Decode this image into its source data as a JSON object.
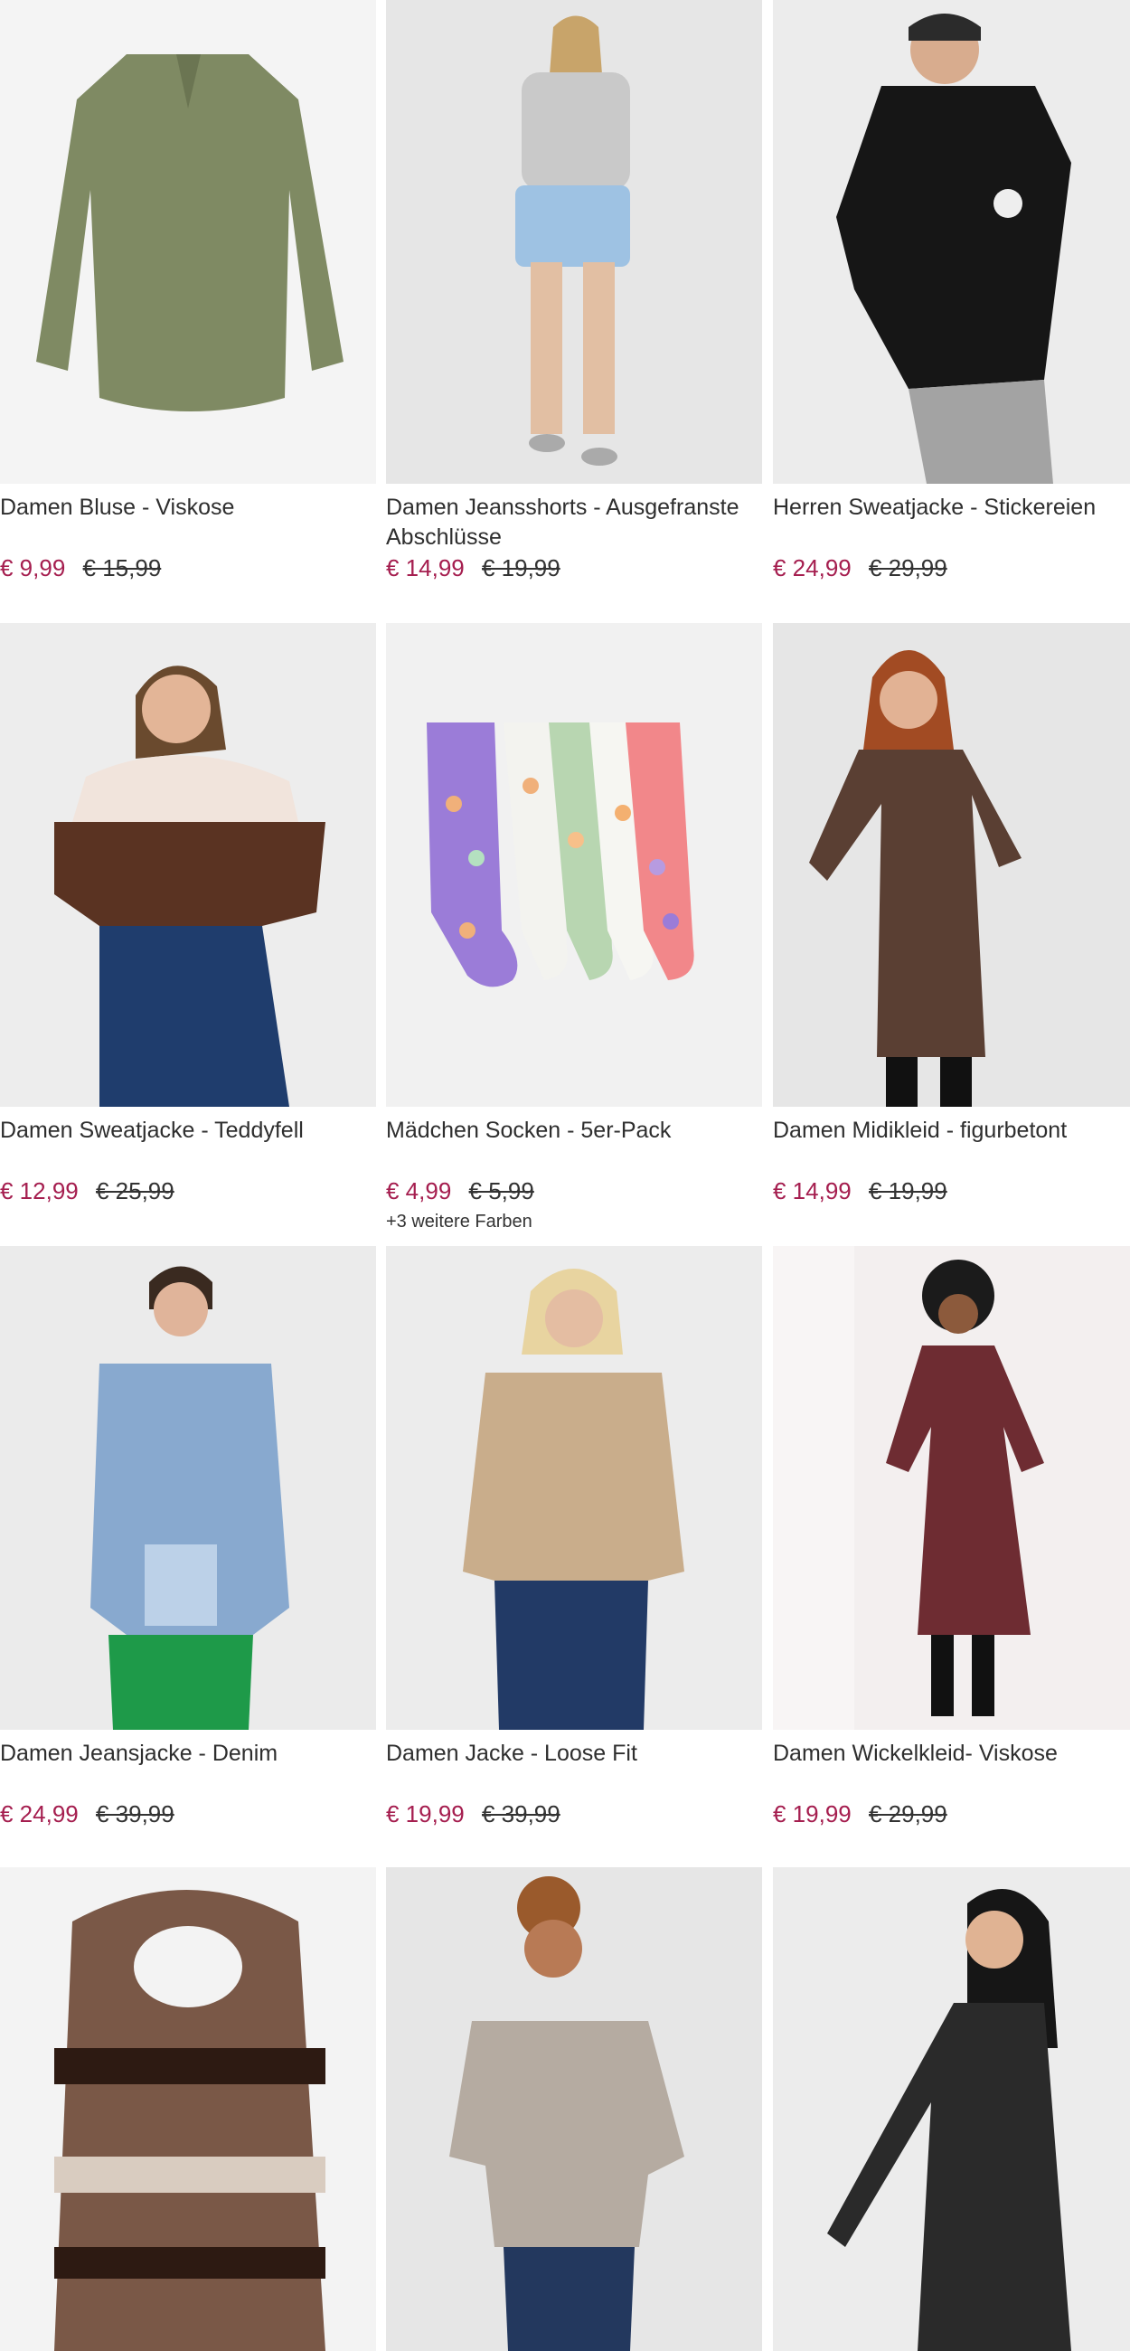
{
  "products": [
    {
      "name": "Damen Bluse - Viskose",
      "price": "€ 9,99",
      "old_price": "€ 15,99"
    },
    {
      "name": "Damen Jeansshorts - Ausgefranste Abschlüsse",
      "price": "€ 14,99",
      "old_price": "€ 19,99"
    },
    {
      "name": "Herren Sweatjacke - Stickereien",
      "price": "€ 24,99",
      "old_price": "€ 29,99"
    },
    {
      "name": "Damen Sweatjacke - Teddyfell",
      "price": "€ 12,99",
      "old_price": "€ 25,99"
    },
    {
      "name": "Mädchen Socken - 5er-Pack",
      "price": "€ 4,99",
      "old_price": "€ 5,99",
      "more_colors": "+3 weitere Farben"
    },
    {
      "name": "Damen Midikleid - figurbetont",
      "price": "€ 14,99",
      "old_price": "€ 19,99"
    },
    {
      "name": "Damen Jeansjacke - Denim",
      "price": "€ 24,99",
      "old_price": "€ 39,99"
    },
    {
      "name": "Damen Jacke - Loose Fit",
      "price": "€ 19,99",
      "old_price": "€ 39,99"
    },
    {
      "name": "Damen Wickelkleid- Viskose",
      "price": "€ 19,99",
      "old_price": "€ 29,99"
    }
  ],
  "colors": {
    "sale_price": "#a51e4f",
    "text": "#2e2e2e",
    "image_bg": "#ededed"
  }
}
